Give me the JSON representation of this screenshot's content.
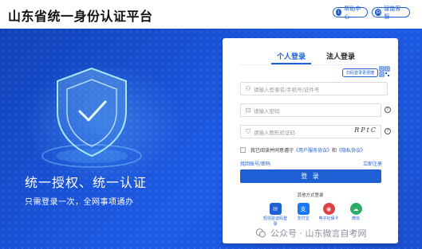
{
  "header": {
    "title": "山东省统一身份认证平台",
    "help_label": "帮助中心",
    "service_label": "智能客服"
  },
  "hero": {
    "slogan_main": "统一授权、统一认证",
    "slogan_sub": "只需登录一次，全网事项通办"
  },
  "login": {
    "tabs": [
      "个人登录",
      "法人登录"
    ],
    "qr_tip": "扫码登录更便捷",
    "username_placeholder": "请输入登录名/手机号/证件号",
    "password_placeholder": "请输入密码",
    "captcha_placeholder": "请输入图形验证码",
    "captcha_text": "RPtC",
    "agree_prefix": "我已阅读并同意遵守",
    "agree_link1": "《用户服务协议》",
    "agree_and": "和",
    "agree_link2": "《隐私协议》",
    "forgot_label": "找回账号/密码",
    "register_label": "立即注册",
    "login_button": "登 录",
    "other_methods_label": "其他方式登录",
    "other_methods": [
      {
        "label": "短信验证码登录",
        "icon": "sms-icon"
      },
      {
        "label": "支付宝",
        "icon": "alipay-icon"
      },
      {
        "label": "电子社保卡",
        "icon": "social-card-icon"
      },
      {
        "label": "微信",
        "icon": "wechat-icon"
      }
    ]
  },
  "watermark": {
    "text": "公众号 · 山东微言自考网"
  },
  "colors": {
    "brand_blue": "#1f5fd6",
    "hero_blue": "#1a4fd0"
  }
}
